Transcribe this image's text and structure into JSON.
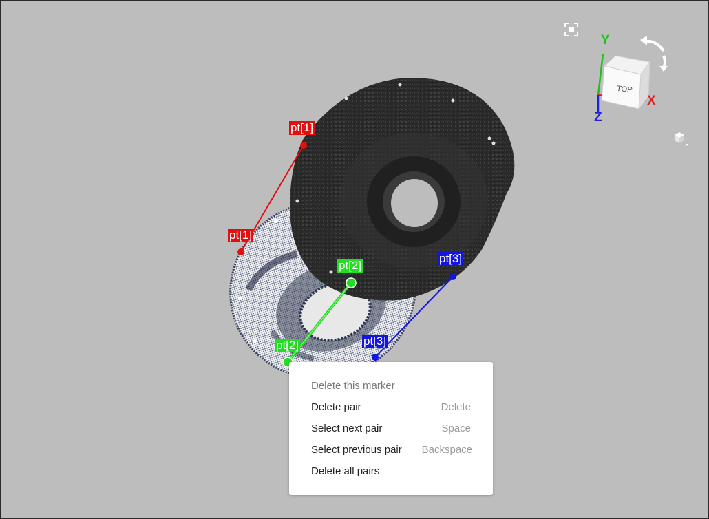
{
  "markers": [
    {
      "label": "pt[1]",
      "color": "#e01010"
    },
    {
      "label": "pt[1]",
      "color": "#e01010"
    },
    {
      "label": "pt[2]",
      "color": "#22dd22"
    },
    {
      "label": "pt[2]",
      "color": "#22dd22"
    },
    {
      "label": "pt[3]",
      "color": "#1414e0"
    },
    {
      "label": "pt[3]",
      "color": "#1414e0"
    }
  ],
  "context_menu": {
    "items": [
      {
        "label": "Delete this marker",
        "shortcut": ""
      },
      {
        "label": "Delete pair",
        "shortcut": "Delete"
      },
      {
        "label": "Select next pair",
        "shortcut": "Space"
      },
      {
        "label": "Select previous pair",
        "shortcut": "Backspace"
      },
      {
        "label": "Delete all pairs",
        "shortcut": ""
      }
    ]
  },
  "view_cube": {
    "face_top": "TOP",
    "axis_x": "X",
    "axis_y": "Y",
    "axis_z": "Z",
    "axis_x_color": "#e02020",
    "axis_y_color": "#20c020",
    "axis_z_color": "#2020e0"
  },
  "icons": {
    "fit_view": "fit-view-icon",
    "rotate": "rotate-arrows-icon",
    "camera": "camera-mode-icon"
  }
}
